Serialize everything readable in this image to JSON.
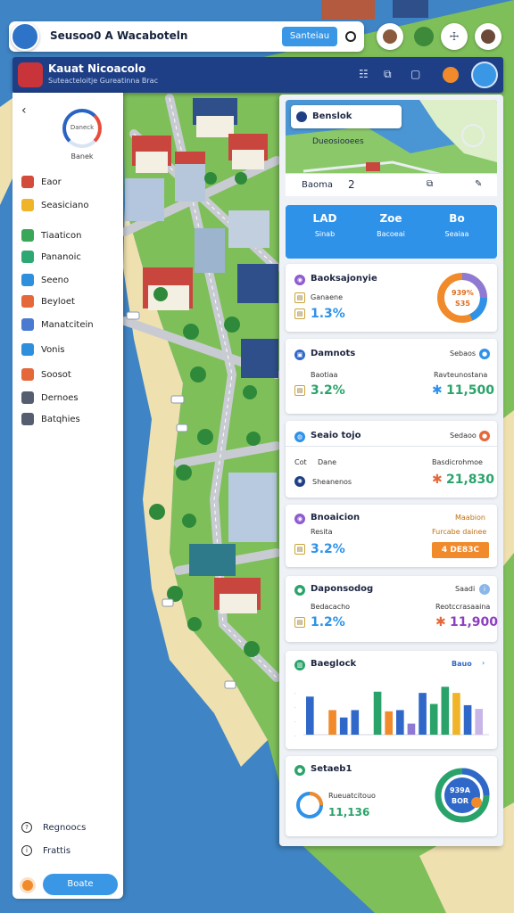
{
  "top_bar": {
    "title": "Seusoo0 A Wacaboteln",
    "search_label": "Santeiau"
  },
  "header": {
    "title": "Kauat Nicoacolo",
    "subtitle": "Suteacteloitje Gureatinna Brac"
  },
  "sidebar": {
    "gauge_label": "Daneck",
    "gauge_sub": "Banek",
    "items": [
      {
        "label": "Eaor",
        "color": "#d24b3b",
        "icon": "flag-icon"
      },
      {
        "label": "Seasiciano",
        "color": "#f0b428",
        "icon": "bookmark-icon"
      },
      {
        "label": "Tiaaticon",
        "color": "#3aa657",
        "icon": "leaf-icon"
      },
      {
        "label": "Pananoic",
        "color": "#2da873",
        "icon": "pin-icon"
      },
      {
        "label": "Seeno",
        "color": "#2e8fdd",
        "icon": "globe-icon"
      },
      {
        "label": "Beyloet",
        "color": "#e5683a",
        "icon": "hammer-icon"
      },
      {
        "label": "Manatcitein",
        "color": "#4a7bd1",
        "icon": "building-icon"
      },
      {
        "label": "Vonis",
        "color": "#2e8fdd",
        "icon": "info-icon"
      },
      {
        "label": "Soosot",
        "color": "#e5683a",
        "icon": "pickaxe-icon"
      },
      {
        "label": "Dernoes",
        "color": "#555e70",
        "icon": "grid-icon"
      },
      {
        "label": "Batqhies",
        "color": "#555e70",
        "icon": "image-icon"
      }
    ],
    "footer_items": [
      "Regnoocs",
      "Frattis"
    ],
    "bottom_button": "Boate"
  },
  "panel": {
    "map_card": {
      "title": "Benslok",
      "tag": "Dueosiooees",
      "foot_label": "Baoma",
      "foot_value": "2"
    },
    "blue_card": [
      {
        "icon": "LAD",
        "label": "Sinab"
      },
      {
        "icon": "Zoe",
        "label": "Bacoeai"
      },
      {
        "icon": "Bo",
        "label": "Seaiaa"
      }
    ],
    "cards": [
      {
        "title": "Baoksajonyie",
        "metric_label": "Ganaene",
        "metric": "1.3%",
        "donut_top": "939%",
        "donut_bot": "S35"
      },
      {
        "title": "Damnots",
        "right": "Sebaos",
        "metric_label": "Baotiaa",
        "metric": "3.2%",
        "right_label": "Ravteunostana",
        "right_value": "11,500"
      },
      {
        "title": "Seaio tojo",
        "right": "Sedaoo",
        "row1_label": "Dane",
        "row1_right": "Basdicrohmoe",
        "row2_label": "Sheanenos",
        "right_value": "21,830"
      },
      {
        "title": "Bnoaicion",
        "right": "Maabion",
        "metric_label": "Resita",
        "metric": "3.2%",
        "right_label": "Furcabe dainee",
        "right_value": "4 DE83C"
      },
      {
        "title": "Daponsodog",
        "right": "Saadi",
        "metric_label": "Bedacacho",
        "metric": "1.2%",
        "right_label": "Reotccrasaaina",
        "right_value": "11,900"
      },
      {
        "title": "Baeglock",
        "right": "Bauo"
      },
      {
        "title": "Setaeb1",
        "metric_label": "Rueuatcitouo",
        "metric": "11,136",
        "donut_top": "939A",
        "donut_bot": "BOR"
      }
    ]
  },
  "chart_data": {
    "type": "bar",
    "categories": [
      "1",
      "2",
      "3",
      "4",
      "5",
      "6",
      "7",
      "8",
      "9",
      "10",
      "11",
      "12",
      "13",
      "14",
      "15",
      "16"
    ],
    "series": [
      {
        "name": "",
        "values": [
          62,
          0,
          40,
          28,
          40,
          0,
          70,
          38,
          40,
          18,
          68,
          50,
          78,
          68,
          48,
          42
        ],
        "colors": [
          "#2f68c8",
          "#2f68c8",
          "#f08a2b",
          "#2f68c8",
          "#2f68c8",
          "#2f68c8",
          "#2aa36b",
          "#f08a2b",
          "#2f68c8",
          "#8e7ad4",
          "#2f68c8",
          "#2aa36b",
          "#2aa36b",
          "#f0b428",
          "#2f68c8",
          "#c9b6e8"
        ]
      }
    ],
    "ylim": [
      0,
      90
    ]
  }
}
